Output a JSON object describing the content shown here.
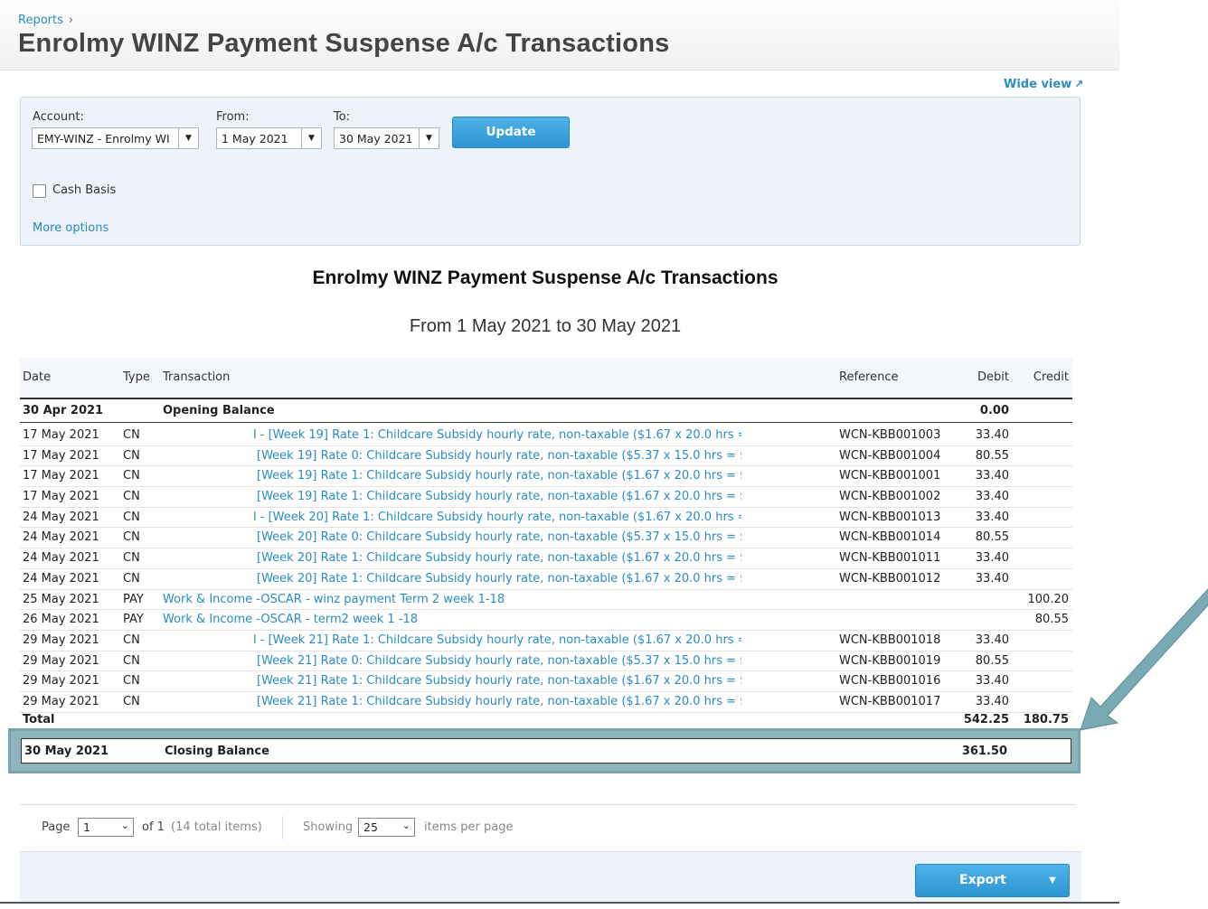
{
  "breadcrumb": {
    "item": "Reports",
    "separator": "›"
  },
  "page_title": "Enrolmy WINZ Payment Suspense A/c Transactions",
  "wide_view": {
    "label": "Wide view",
    "icon": "external-link-icon"
  },
  "filters": {
    "account_label": "Account:",
    "account_value": "EMY-WINZ - Enrolmy WI",
    "from_label": "From:",
    "from_value": "1 May 2021",
    "to_label": "To:",
    "to_value": "30 May 2021",
    "update_label": "Update",
    "cash_basis_label": "Cash Basis",
    "more_options_label": "More options"
  },
  "report": {
    "title": "Enrolmy WINZ Payment Suspense A/c Transactions",
    "subtitle": "From 1 May 2021 to 30 May 2021",
    "columns": {
      "date": "Date",
      "type": "Type",
      "transaction": "Transaction",
      "reference": "Reference",
      "debit": "Debit",
      "credit": "Credit"
    },
    "opening": {
      "date": "30 Apr 2021",
      "label": "Opening Balance",
      "debit": "0.00"
    },
    "rows": [
      {
        "date": "17 May 2021",
        "type": "CN",
        "transaction": "l - [Week 19] Rate 1: Childcare Subsidy hourly rate, non-taxable ($1.67 x 20.0 hrs = ...",
        "reference": "WCN-KBB001003",
        "debit": "33.40",
        "credit": ""
      },
      {
        "date": "17 May 2021",
        "type": "CN",
        "transaction": "[Week 19] Rate 0: Childcare Subsidy hourly rate, non-taxable ($5.37 x 15.0 hrs = $...",
        "reference": "WCN-KBB001004",
        "debit": "80.55",
        "credit": ""
      },
      {
        "date": "17 May 2021",
        "type": "CN",
        "transaction": "[Week 19] Rate 1: Childcare Subsidy hourly rate, non-taxable ($1.67 x 20.0 hrs = $3...",
        "reference": "WCN-KBB001001",
        "debit": "33.40",
        "credit": ""
      },
      {
        "date": "17 May 2021",
        "type": "CN",
        "transaction": "[Week 19] Rate 1: Childcare Subsidy hourly rate, non-taxable ($1.67 x 20.0 hrs = $3...",
        "reference": "WCN-KBB001002",
        "debit": "33.40",
        "credit": ""
      },
      {
        "date": "24 May 2021",
        "type": "CN",
        "transaction": "l - [Week 20] Rate 1: Childcare Subsidy hourly rate, non-taxable ($1.67 x 20.0 hrs = ...",
        "reference": "WCN-KBB001013",
        "debit": "33.40",
        "credit": ""
      },
      {
        "date": "24 May 2021",
        "type": "CN",
        "transaction": "[Week 20] Rate 0: Childcare Subsidy hourly rate, non-taxable ($5.37 x 15.0 hrs = $...",
        "reference": "WCN-KBB001014",
        "debit": "80.55",
        "credit": ""
      },
      {
        "date": "24 May 2021",
        "type": "CN",
        "transaction": "[Week 20] Rate 1: Childcare Subsidy hourly rate, non-taxable ($1.67 x 20.0 hrs = $3...",
        "reference": "WCN-KBB001011",
        "debit": "33.40",
        "credit": ""
      },
      {
        "date": "24 May 2021",
        "type": "CN",
        "transaction": "[Week 20] Rate 1: Childcare Subsidy hourly rate, non-taxable ($1.67 x 20.0 hrs = $3...",
        "reference": "WCN-KBB001012",
        "debit": "33.40",
        "credit": ""
      },
      {
        "date": "25 May 2021",
        "type": "PAY",
        "transaction": "Work & Income -OSCAR - winz payment Term 2 week 1-18",
        "reference": "",
        "debit": "",
        "credit": "100.20"
      },
      {
        "date": "26 May 2021",
        "type": "PAY",
        "transaction": "Work & Income -OSCAR - term2 week 1 -18",
        "reference": "",
        "debit": "",
        "credit": "80.55"
      },
      {
        "date": "29 May 2021",
        "type": "CN",
        "transaction": "l - [Week 21] Rate 1: Childcare Subsidy hourly rate, non-taxable ($1.67 x 20.0 hrs = ...",
        "reference": "WCN-KBB001018",
        "debit": "33.40",
        "credit": ""
      },
      {
        "date": "29 May 2021",
        "type": "CN",
        "transaction": "[Week 21] Rate 0: Childcare Subsidy hourly rate, non-taxable ($5.37 x 15.0 hrs = $...",
        "reference": "WCN-KBB001019",
        "debit": "80.55",
        "credit": ""
      },
      {
        "date": "29 May 2021",
        "type": "CN",
        "transaction": "[Week 21] Rate 1: Childcare Subsidy hourly rate, non-taxable ($1.67 x 20.0 hrs = $3...",
        "reference": "WCN-KBB001016",
        "debit": "33.40",
        "credit": ""
      },
      {
        "date": "29 May 2021",
        "type": "CN",
        "transaction": "[Week 21] Rate 1: Childcare Subsidy hourly rate, non-taxable ($1.67 x 20.0 hrs = $3...",
        "reference": "WCN-KBB001017",
        "debit": "33.40",
        "credit": ""
      }
    ],
    "total": {
      "label": "Total",
      "debit": "542.25",
      "credit": "180.75"
    },
    "closing": {
      "date": "30 May 2021",
      "label": "Closing Balance",
      "debit": "361.50"
    }
  },
  "pager": {
    "page_label": "Page",
    "page_value": "1",
    "of_label": "of 1",
    "total_items": "(14 total items)",
    "showing_label": "Showing",
    "per_page_value": "25",
    "items_per_page_label": "items per page"
  },
  "export_label": "Export",
  "colors": {
    "accent": "#2b8cc4",
    "button": "#3aa3dd",
    "highlight": "#8fb5bc"
  }
}
